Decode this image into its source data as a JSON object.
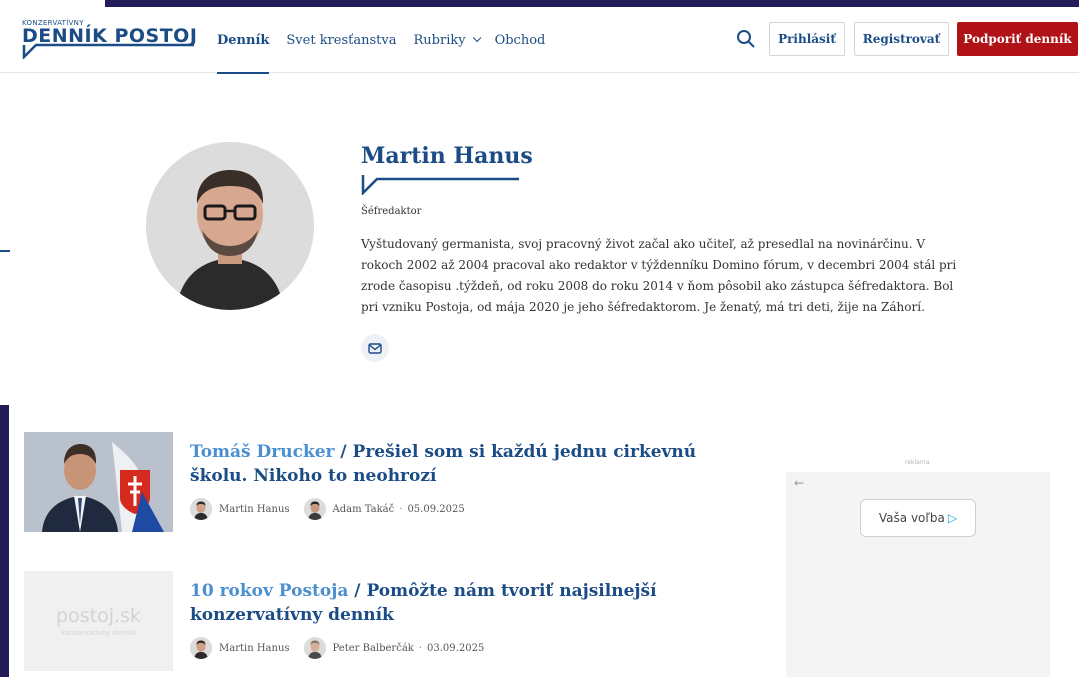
{
  "header": {
    "logo_small": "KONZERVATÍVNY",
    "logo_main": "DENNÍK POSTOJ",
    "nav": [
      {
        "label": "Denník",
        "active": true
      },
      {
        "label": "Svet kresťanstva",
        "active": false
      },
      {
        "label": "Rubriky",
        "active": false,
        "dropdown": true
      },
      {
        "label": "Obchod",
        "active": false
      }
    ],
    "search_icon": "search-icon",
    "login_label": "Prihlásiť",
    "register_label": "Registrovať",
    "support_label": "Podporiť denník"
  },
  "profile": {
    "name": "Martin Hanus",
    "role": "Šéfredaktor",
    "bio": "Vyštudovaný germanista, svoj pracovný život začal ako učiteľ, až presedlal na novinárčinu. V rokoch 2002 až 2004 pracoval ako redaktor v týždenníku Domino fórum, v decembri 2004 stál pri zrode časopisu .týždeň, od roku 2008 do roku 2014 v ňom pôsobil ako zástupca šéfredaktora. Bol pri vzniku Postoja, od mája 2020 je jeho šéfredaktorom. Je ženatý, má tri deti, žije na Záhorí.",
    "mail_icon": "mail-icon"
  },
  "articles": [
    {
      "kicker": "Tomáš Drucker",
      "title": "Prešiel som si každú jednu cirkevnú školu. Nikoho to neohrozí",
      "author1": "Martin Hanus",
      "author2": "Adam Takáč",
      "date": "05.09.2025"
    },
    {
      "kicker": "10 rokov Postoja",
      "title": "Pomôžte nám tvoriť najsilnejší konzervatívny denník",
      "author1": "Martin Hanus",
      "author2": "Peter Balberčák",
      "date": "03.09.2025",
      "placeholder_main": "postoj.sk",
      "placeholder_sub": "konzervatívny denník"
    }
  ],
  "ad": {
    "label": "reklama",
    "back": "←",
    "button": "Vaša voľba",
    "colors": {
      "accent": "#1aa3e0"
    }
  },
  "colors": {
    "brand": "#1b4c85",
    "support": "#b01217",
    "frame": "#231c5a"
  }
}
